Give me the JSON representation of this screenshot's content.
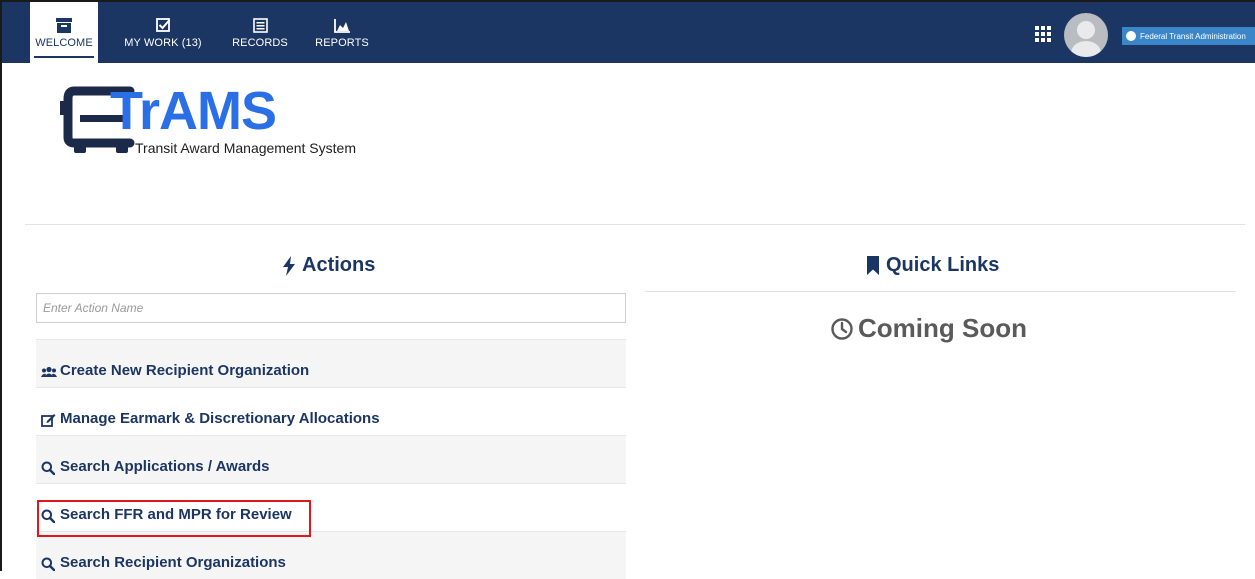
{
  "nav": {
    "tabs": [
      {
        "label": "WELCOME",
        "icon": "archive-box-icon"
      },
      {
        "label": "MY WORK (13)",
        "icon": "checkbox-icon"
      },
      {
        "label": "RECORDS",
        "icon": "list-icon"
      },
      {
        "label": "REPORTS",
        "icon": "area-chart-icon"
      }
    ],
    "active_tab": "WELCOME",
    "org_badge": "Federal Transit Administration"
  },
  "logo": {
    "title": "TrAMS",
    "subtitle": "Transit Award Management System"
  },
  "actions": {
    "heading": "Actions",
    "search_placeholder": "Enter Action Name",
    "items": [
      {
        "label": "Create New Recipient Organization",
        "icon": "users-icon"
      },
      {
        "label": "Manage Earmark & Discretionary Allocations",
        "icon": "edit-icon"
      },
      {
        "label": "Search Applications  / Awards",
        "icon": "search-icon"
      },
      {
        "label": "Search FFR and MPR for Review",
        "icon": "search-icon",
        "highlighted": true
      },
      {
        "label": "Search Recipient Organizations",
        "icon": "search-icon"
      }
    ]
  },
  "quick_links": {
    "heading": "Quick Links",
    "status": "Coming Soon"
  },
  "colors": {
    "nav_bg": "#1c3664",
    "logo_blue": "#2b6fe6",
    "highlight_red": "#e0181b",
    "badge_blue": "#3a86c8"
  }
}
